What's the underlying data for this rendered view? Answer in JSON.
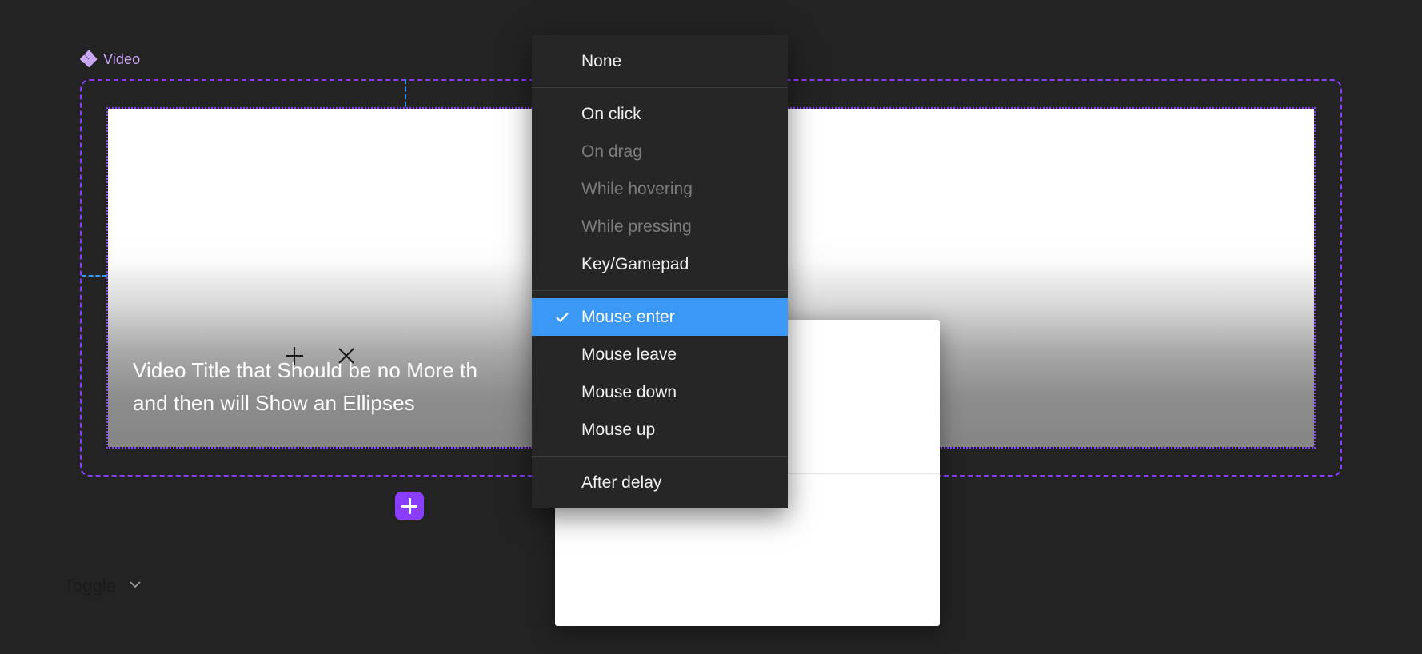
{
  "canvas": {
    "component_label": "Video",
    "component_icon": "diamond-component-icon",
    "add_button_icon": "plus-icon",
    "accent_color": "#8b3dff",
    "guide_color": "#2f9bff",
    "background_color": "#232323"
  },
  "video_card": {
    "title_line_1": "Video Title that Should be no More th",
    "title_line_2": "and then will Show an Ellipses"
  },
  "panel": {
    "plus_icon": "plus-icon",
    "close_icon": "close-icon",
    "select_value": "Toggle",
    "select_chevron_icon": "chevron-down-icon"
  },
  "menu": {
    "selected_color": "#3b99f5",
    "groups": [
      {
        "items": [
          {
            "label": "None",
            "state": "enabled",
            "checked": false
          }
        ]
      },
      {
        "items": [
          {
            "label": "On click",
            "state": "enabled",
            "checked": false
          },
          {
            "label": "On drag",
            "state": "disabled",
            "checked": false
          },
          {
            "label": "While hovering",
            "state": "disabled",
            "checked": false
          },
          {
            "label": "While pressing",
            "state": "disabled",
            "checked": false
          },
          {
            "label": "Key/Gamepad",
            "state": "enabled",
            "checked": false
          }
        ]
      },
      {
        "items": [
          {
            "label": "Mouse enter",
            "state": "enabled",
            "checked": true
          },
          {
            "label": "Mouse leave",
            "state": "enabled",
            "checked": false
          },
          {
            "label": "Mouse down",
            "state": "enabled",
            "checked": false
          },
          {
            "label": "Mouse up",
            "state": "enabled",
            "checked": false
          }
        ]
      },
      {
        "items": [
          {
            "label": "After delay",
            "state": "enabled",
            "checked": false
          }
        ]
      }
    ]
  }
}
